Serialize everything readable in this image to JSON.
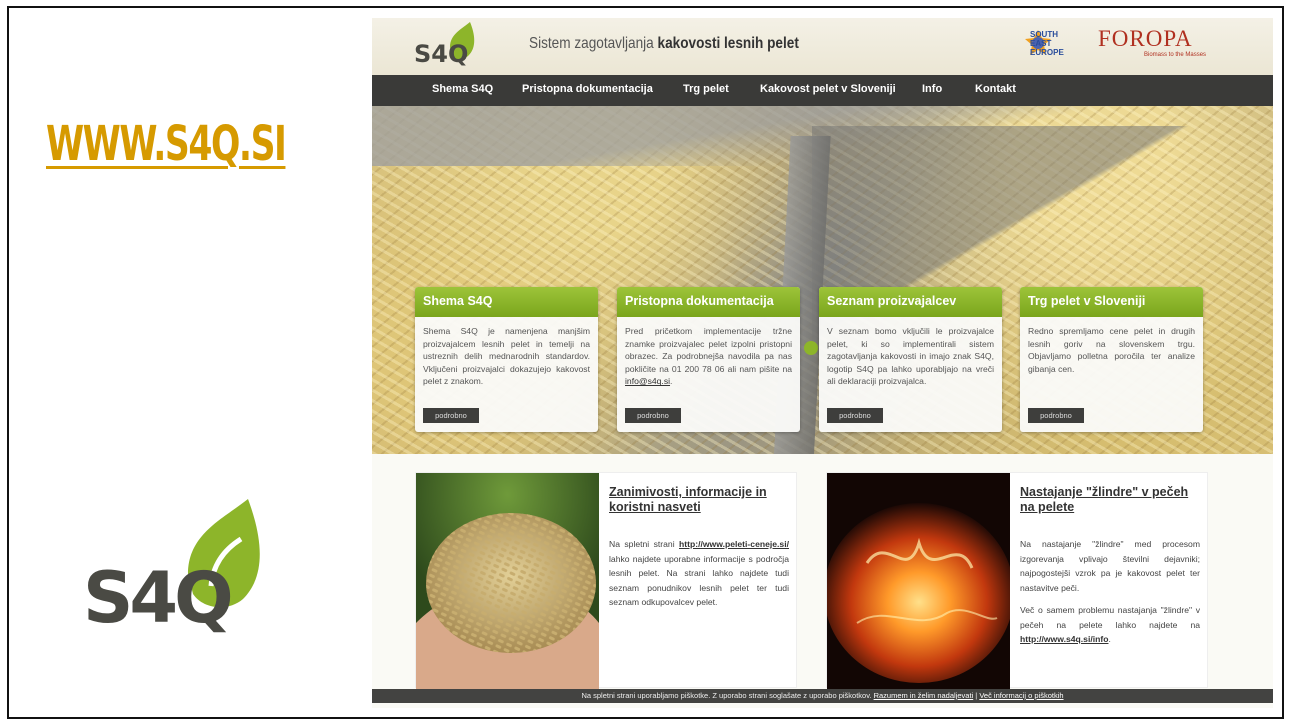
{
  "slide": {
    "url_title": "WWW.S4Q.SI",
    "logo_text": "S4Q"
  },
  "site": {
    "logo_text": "S4Q",
    "tagline_prefix": "Sistem zagotavljanja ",
    "tagline_bold": "kakovosti lesnih pelet",
    "partner1": "SOUTH EAST EUROPE",
    "partner2": "FOROPA",
    "partner2_sub": "Biomass to the Masses",
    "nav": [
      "Shema S4Q",
      "Pristopna dokumentacija",
      "Trg pelet",
      "Kakovost pelet v Sloveniji",
      "Info",
      "Kontakt"
    ],
    "cards": [
      {
        "title": "Shema S4Q",
        "text": "Shema S4Q je namenjena manjšim proizvajalcem lesnih pelet in temelji na ustreznih delih mednarodnih standardov. Vključeni proizvajalci dokazujejo kakovost pelet z znakom.",
        "button": "podrobno"
      },
      {
        "title": "Pristopna dokumentacija",
        "text_before": "Pred pričetkom implementacije tržne znamke proizvajalec pelet izpolni pristopni obrazec. Za podrobnejša navodila pa nas pokličite na 01 200 78 06 ali nam pišite na ",
        "text_link": "info@s4q.si",
        "text_after": ".",
        "button": "podrobno"
      },
      {
        "title": "Seznam proizvajalcev",
        "text": "V seznam bomo vključili le proizvajalce pelet, ki so implementirali sistem zagotavljanja kakovosti in imajo znak S4Q, logotip S4Q pa lahko uporabljajo na vreči ali deklaraciji proizvajalca.",
        "button": "podrobno"
      },
      {
        "title": "Trg pelet v Sloveniji",
        "text": "Redno spremljamo cene pelet in drugih lesnih goriv na slovenskem trgu. Objavljamo polletna poročila ter analize gibanja cen.",
        "button": "podrobno"
      }
    ],
    "features": [
      {
        "title": "Zanimivosti, informacije in koristni nasveti",
        "p1_before": "Na spletni strani ",
        "p1_link": "http://www.peleti-ceneje.si/",
        "p1_after": " lahko najdete uporabne informacije s področja lesnih pelet. Na strani lahko najdete tudi seznam ponudnikov lesnih pelet ter tudi seznam odkupovalcev pelet."
      },
      {
        "title": "Nastajanje \"žlindre\" v pečeh na pelete",
        "p1": "Na nastajanje \"žlindre\" med procesom izgorevanja vplivajo številni dejavniki; najpogostejši vzrok pa je kakovost pelet ter nastavitve peči.",
        "p2_before": "Več o samem problemu nastajanja \"žlindre\" v pečeh na pelete lahko najdete na ",
        "p2_link": "http://www.s4q.si/info",
        "p2_after": "."
      }
    ],
    "cookie": {
      "text": "Na spletni strani uporabljamo piškotke. Z uporabo strani soglašate z uporabo piškotkov. ",
      "accept": "Razumem in želim nadaljevati",
      "sep": " | ",
      "more": "Več informacij o piškotkih"
    }
  },
  "colors": {
    "accent_green": "#8db52a",
    "title_gold": "#d69a00",
    "logo_grey": "#4a4a44",
    "nav_dark": "#3a3a38"
  }
}
